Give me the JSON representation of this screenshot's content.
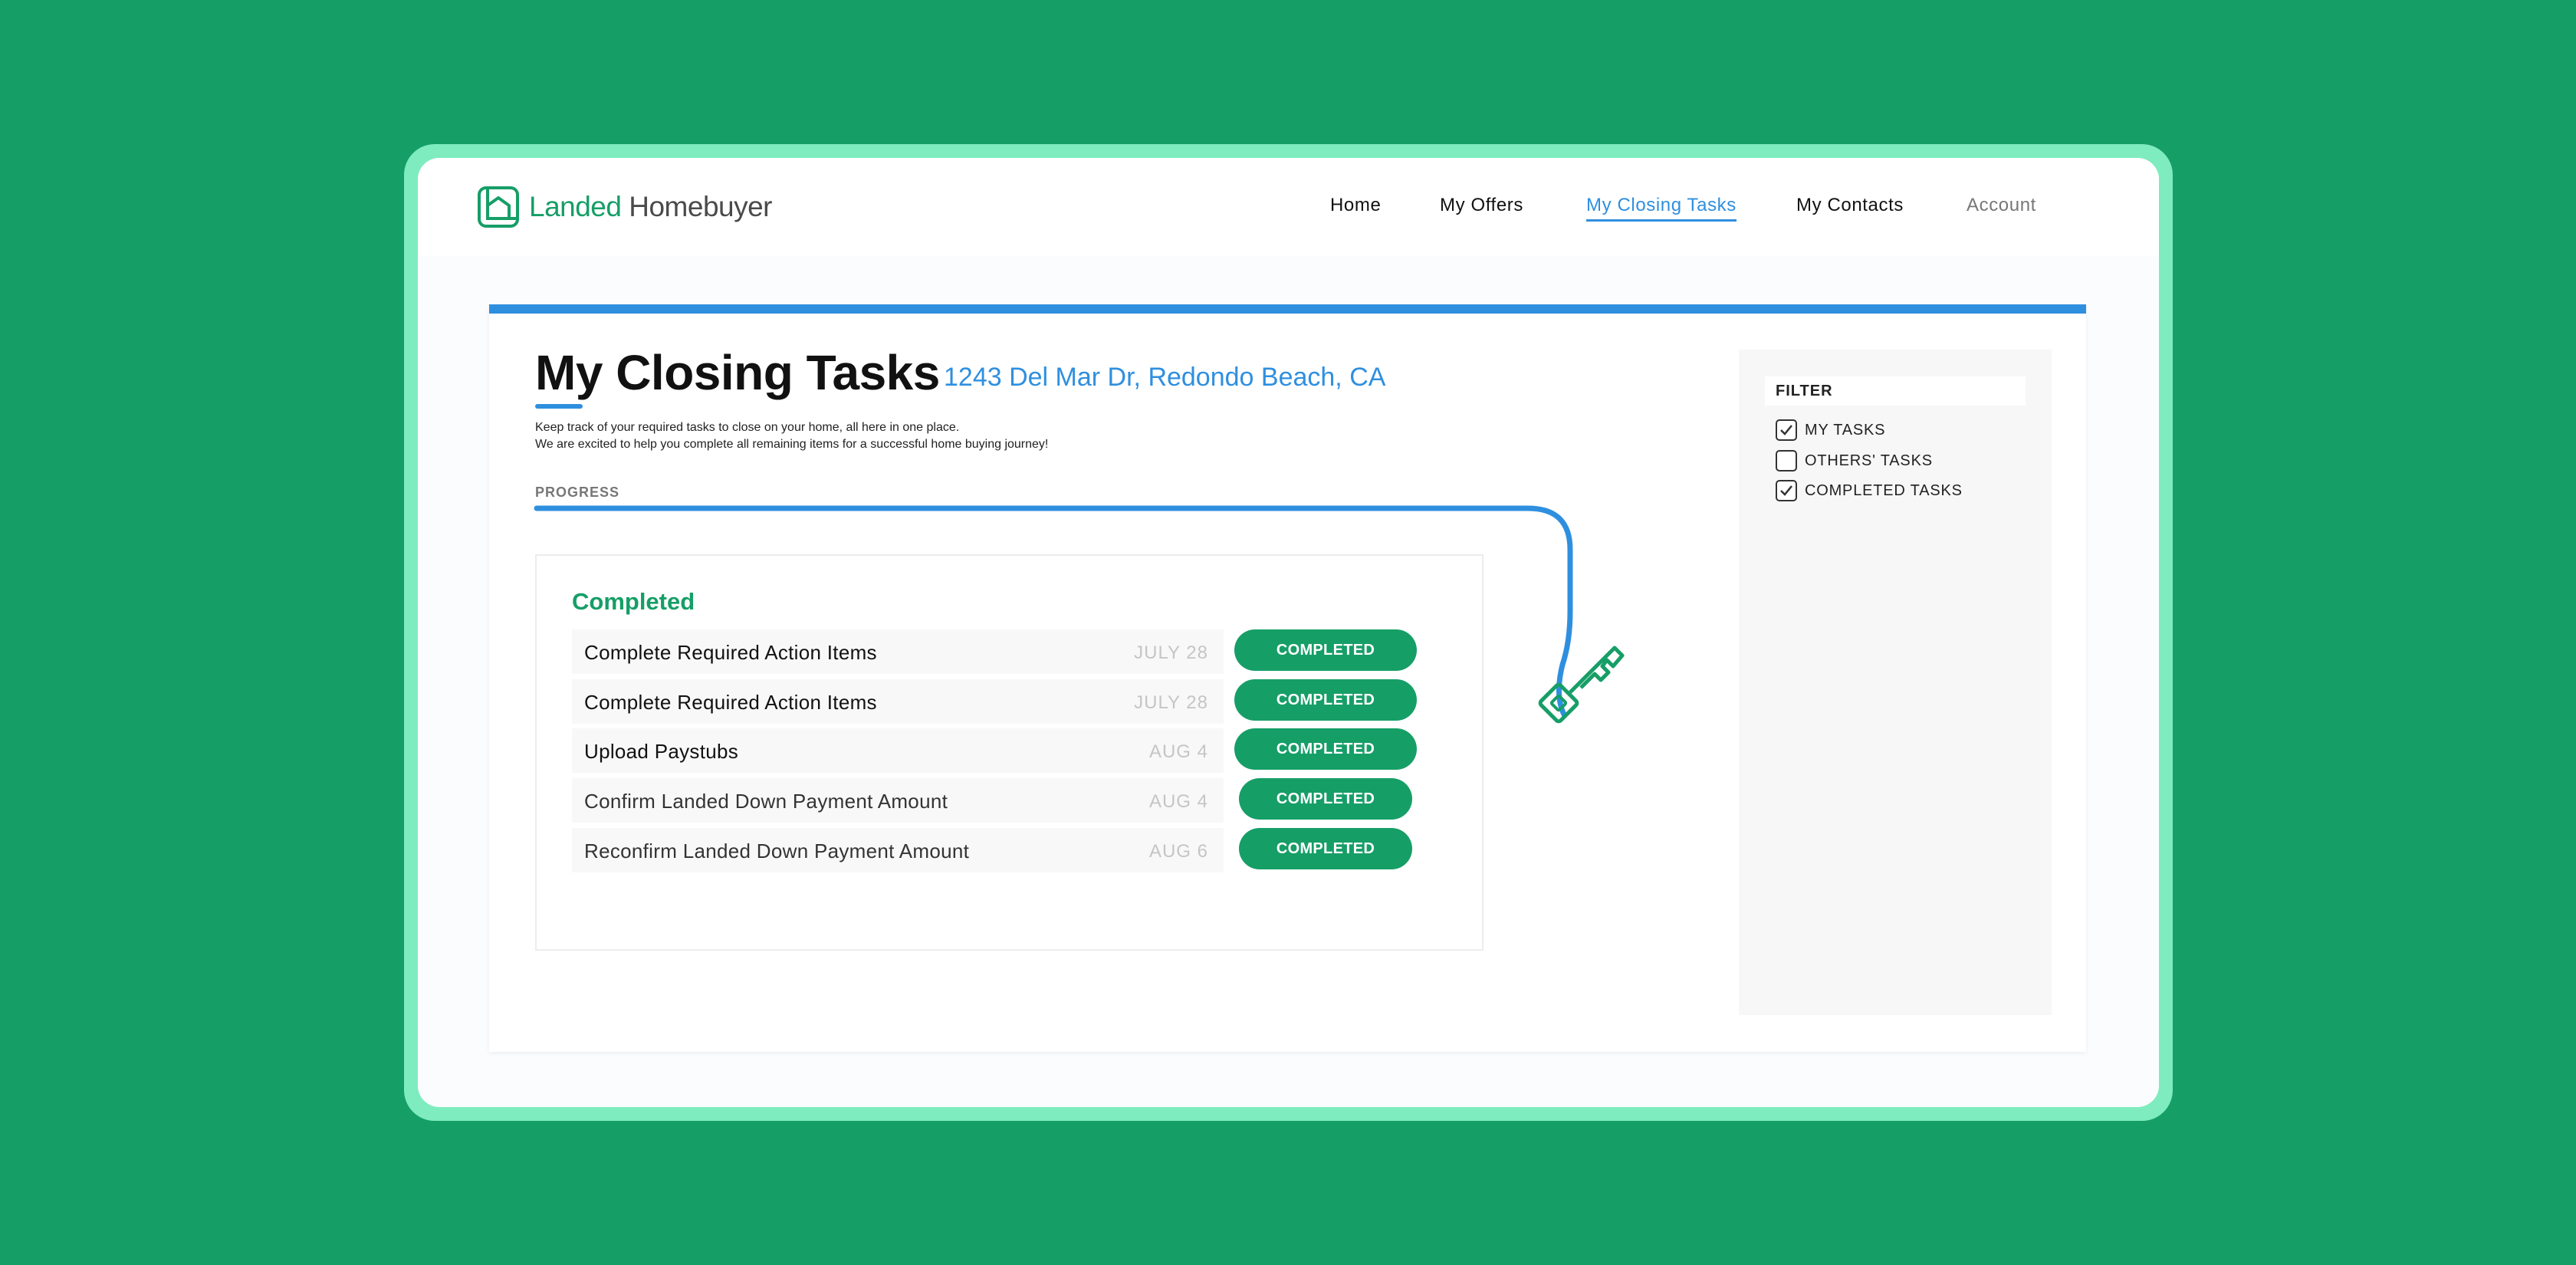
{
  "colors": {
    "background": "#169e67",
    "frame": "#7eecbf",
    "brand_green": "#169e67",
    "accent_blue": "#2f8fdf"
  },
  "brand": {
    "name_part1": "Landed",
    "name_part2": "Homebuyer",
    "logo_icon": "house-logo-icon"
  },
  "nav": {
    "items": [
      {
        "label": "Home",
        "active": false
      },
      {
        "label": "My Offers",
        "active": false
      },
      {
        "label": "My Closing Tasks",
        "active": true
      },
      {
        "label": "My Contacts",
        "active": false
      },
      {
        "label": "Account",
        "active": false
      }
    ]
  },
  "page": {
    "title": "My Closing Tasks",
    "address": "1243 Del Mar Dr, Redondo Beach, CA",
    "description_line1": "Keep track of your required tasks to close on your home, all here in one place.",
    "description_line2": "We are excited to help you complete all remaining items for a successful home buying journey!",
    "progress_label": "PROGRESS",
    "progress_icon": "key-icon"
  },
  "completed_section": {
    "title": "Completed",
    "tasks": [
      {
        "name": "Complete Required Action Items",
        "date": "JULY 28",
        "status": "COMPLETED"
      },
      {
        "name": "Complete Required Action Items",
        "date": "JULY 28",
        "status": "COMPLETED"
      },
      {
        "name": "Upload Paystubs",
        "date": "AUG 4",
        "status": "COMPLETED"
      },
      {
        "name": "Confirm Landed Down Payment Amount",
        "date": "AUG 4",
        "status": "COMPLETED"
      },
      {
        "name": "Reconfirm Landed Down Payment Amount",
        "date": "AUG 6",
        "status": "COMPLETED"
      }
    ]
  },
  "filter": {
    "title": "FILTER",
    "options": [
      {
        "label": "MY TASKS",
        "checked": true
      },
      {
        "label": "OTHERS' TASKS",
        "checked": false
      },
      {
        "label": "COMPLETED TASKS",
        "checked": true
      }
    ]
  }
}
